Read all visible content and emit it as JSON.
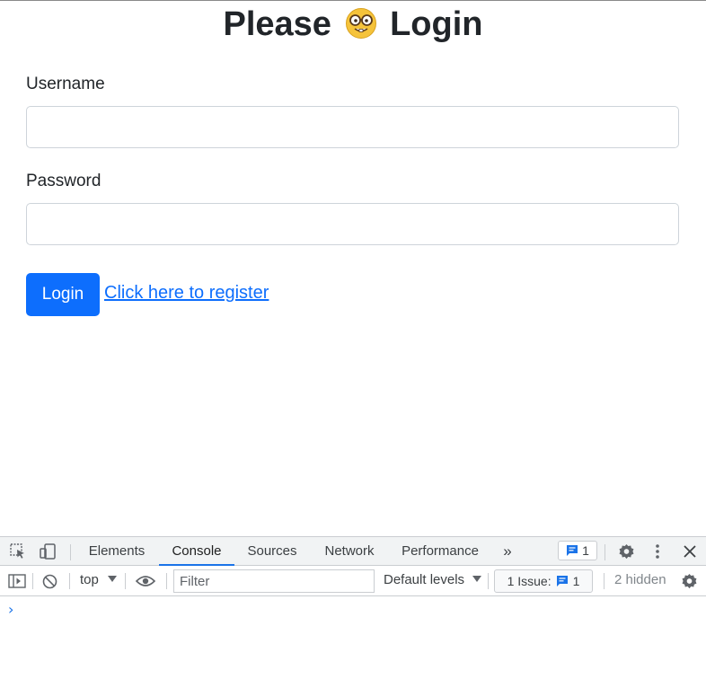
{
  "page": {
    "title_before": "Please",
    "title_after": "Login",
    "title_icon": "nerd-face-emoji",
    "username_label": "Username",
    "username_value": "",
    "password_label": "Password",
    "password_value": "",
    "login_button": "Login",
    "register_link": "Click here to register",
    "colors": {
      "primary": "#0d6efd",
      "text": "#212529",
      "input_border": "#ced4da"
    }
  },
  "devtools": {
    "tabs": [
      {
        "label": "Elements",
        "active": false
      },
      {
        "label": "Console",
        "active": true
      },
      {
        "label": "Sources",
        "active": false
      },
      {
        "label": "Network",
        "active": false
      },
      {
        "label": "Performance",
        "active": false
      }
    ],
    "more_tabs": "»",
    "messages_count": "1",
    "toolbar": {
      "context": "top",
      "filter_placeholder": "Filter",
      "filter_value": "",
      "levels": "Default levels",
      "issues_label": "1 Issue:",
      "issues_count": "1",
      "hidden": "2 hidden"
    },
    "console_prompt": "›",
    "icons": [
      "inspect-icon",
      "device-toggle-icon",
      "settings-icon",
      "more-vert-icon",
      "close-icon",
      "sidebar-toggle-icon",
      "clear-console-icon",
      "eye-icon",
      "message-icon"
    ],
    "accent": "#1a73e8"
  }
}
